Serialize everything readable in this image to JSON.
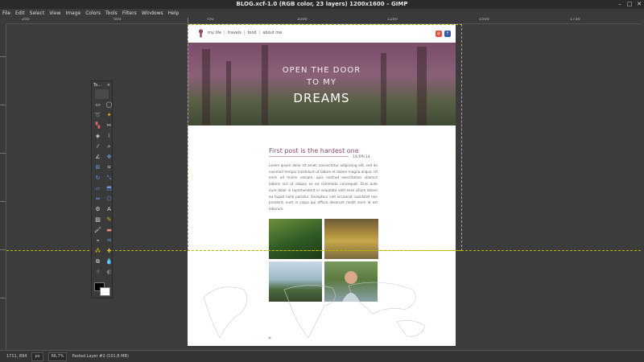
{
  "window": {
    "title": "BLOG.xcf-1.0 (RGB color, 23 layers) 1200x1600 – GIMP",
    "controls": [
      "–",
      "□",
      "✕"
    ]
  },
  "menu": [
    "File",
    "Edit",
    "Select",
    "View",
    "Image",
    "Colors",
    "Tools",
    "Filters",
    "Windows",
    "Help"
  ],
  "ruler": {
    "labels": [
      "250",
      "500",
      "750",
      "1000",
      "1250",
      "1500",
      "1750"
    ]
  },
  "toolbox": {
    "title": "To...",
    "close": "×"
  },
  "document": {
    "nav_links": [
      "my life",
      "travels",
      "food",
      "about me"
    ],
    "hero_lines": [
      "OPEN THE DOOR",
      "TO MY",
      "DREAMS"
    ],
    "post_title": "First post is the hardest one",
    "post_date": "14/09/14",
    "post_body": "Lorem ipsum dolor sit amet, consectetur adipiscing elit, sed do eiusmod tempor incididunt ut labore et dolore magna aliqua. Ut enim ad minim veniam, quis nostrud exercitation ullamco laboris nisi ut aliquip ex ea commodo consequat. Duis aute irure dolor in reprehenderit in voluptate velit esse cillum dolore eu fugiat nulla pariatur. Excepteur sint occaecat cupidatat non proident, sunt in culpa qui officia deserunt mollit anim id est laborum."
  },
  "status": {
    "coords": "1711, 894",
    "unit": "px",
    "zoom": "66,7%",
    "layer_info": "Pasted Layer #2 (101,6 MB)"
  },
  "colors": {
    "accent": "#8a4a6a",
    "guide": "#b8b800",
    "social_1": "#e0503a",
    "social_2": "#3a5aa0"
  }
}
